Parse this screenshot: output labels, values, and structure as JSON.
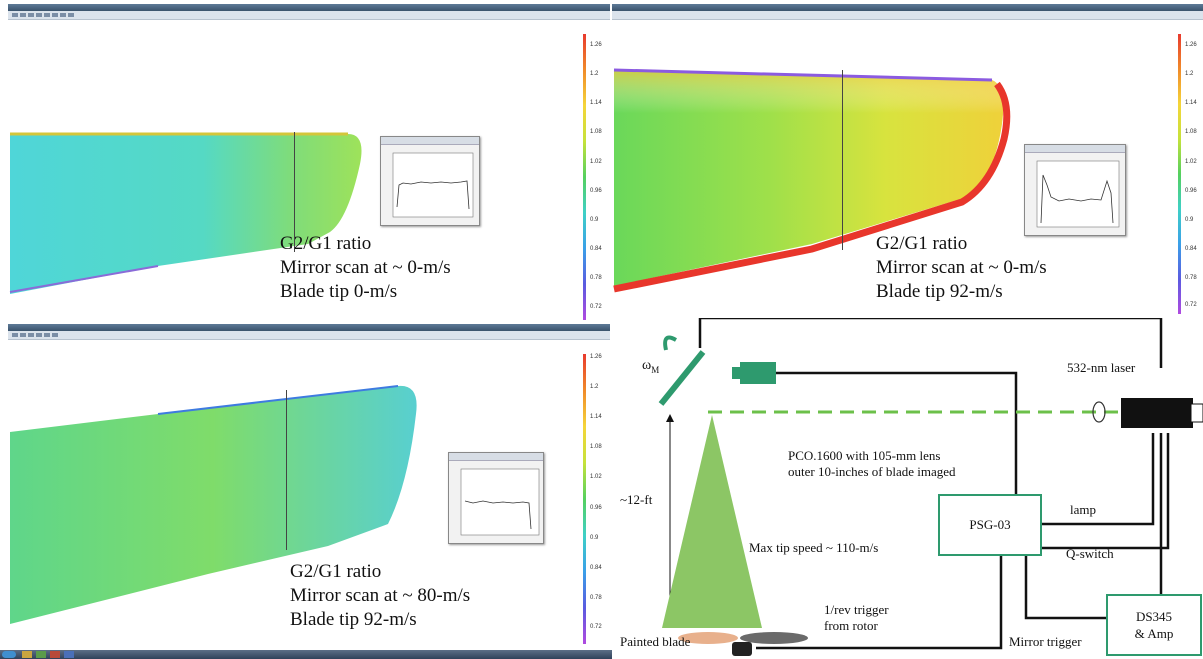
{
  "panels": [
    {
      "caption": [
        "G2/G1 ratio",
        "Mirror scan at ~ 0-m/s",
        "Blade tip 0-m/s"
      ],
      "colorbar_ticks": [
        "1.26",
        "1.2",
        "1.14",
        "1.08",
        "1.02",
        "0.96",
        "0.9",
        "0.84",
        "0.78",
        "0.72"
      ]
    },
    {
      "caption": [
        "G2/G1 ratio",
        "Mirror scan at ~ 0-m/s",
        "Blade tip 92-m/s"
      ],
      "colorbar_ticks": [
        "1.26",
        "1.2",
        "1.14",
        "1.08",
        "1.02",
        "0.96",
        "0.9",
        "0.84",
        "0.78",
        "0.72"
      ]
    },
    {
      "caption": [
        "G2/G1 ratio",
        "Mirror scan at ~ 80-m/s",
        "Blade tip 92-m/s"
      ],
      "colorbar_ticks": [
        "1.26",
        "1.2",
        "1.14",
        "1.08",
        "1.02",
        "0.96",
        "0.9",
        "0.84",
        "0.78",
        "0.72"
      ]
    }
  ],
  "schematic": {
    "omega_label": "ω",
    "omega_sub": "M",
    "laser_label": "532-nm laser",
    "camera_label_line1": "PCO.1600 with 105-mm lens",
    "camera_label_line2": "outer 10-inches of blade imaged",
    "height_label": "~12-ft",
    "tip_speed_label": "Max tip speed ~ 110-m/s",
    "psg_label": "PSG-03",
    "lamp_label": "lamp",
    "qswitch_label": "Q-switch",
    "trigger_line1": "1/rev trigger",
    "trigger_line2": "from rotor",
    "painted_blade_label": "Painted blade",
    "mirror_trigger_label": "Mirror trigger",
    "ds345_line1": "DS345",
    "ds345_line2": "& Amp"
  },
  "colors": {
    "accent_green": "#2e9a6e",
    "beam_green": "#6cc04a",
    "cone_green": "#8cc665"
  }
}
